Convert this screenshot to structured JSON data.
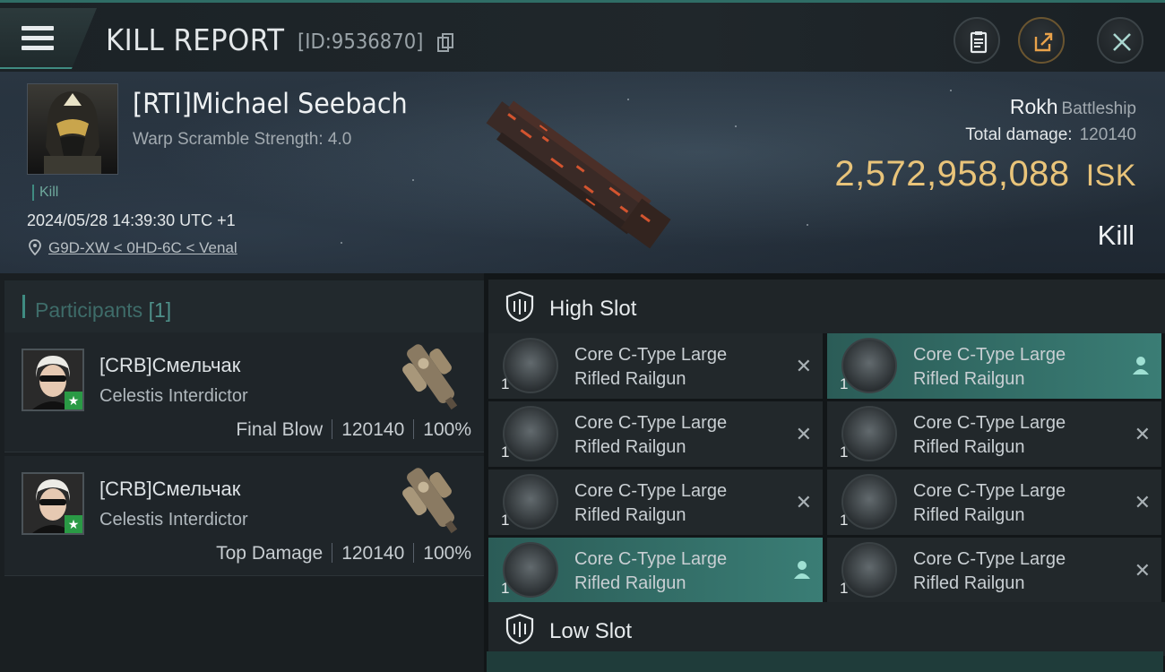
{
  "header": {
    "title": "KILL REPORT",
    "report_id": "[ID:9536870]"
  },
  "victim": {
    "name": "[RTI]Michael Seebach",
    "warp_scramble": "Warp Scramble Strength: 4.0",
    "kill_tag": "Kill",
    "datetime": "2024/05/28 14:39:30 UTC +1",
    "location": "G9D-XW < 0HD-6C < Venal"
  },
  "ship": {
    "name": "Rokh",
    "class": "Battleship",
    "total_damage_label": "Total damage:",
    "total_damage": "120140",
    "isk_value": "2,572,958,088",
    "isk_unit": "ISK",
    "result": "Kill"
  },
  "participants": {
    "label": "Participants",
    "count": "[1]",
    "rows": [
      {
        "name": "[CRB]Смельчак",
        "ship": "Celestis Interdictor",
        "role": "Final Blow",
        "damage": "120140",
        "percent": "100%"
      },
      {
        "name": "[CRB]Смельчак",
        "ship": "Celestis Interdictor",
        "role": "Top Damage",
        "damage": "120140",
        "percent": "100%"
      }
    ]
  },
  "slots": {
    "high_label": "High Slot",
    "low_label": "Low Slot",
    "items": [
      {
        "line1": "Core C-Type Large",
        "line2": "Rifled Railgun",
        "qty": "1",
        "action": "✕"
      },
      {
        "line1": "Core C-Type Large",
        "line2": "Rifled Railgun",
        "qty": "1",
        "action": "person"
      },
      {
        "line1": "Core C-Type Large",
        "line2": "Rifled Railgun",
        "qty": "1",
        "action": "✕"
      },
      {
        "line1": "Core C-Type Large",
        "line2": "Rifled Railgun",
        "qty": "1",
        "action": "✕"
      },
      {
        "line1": "Core C-Type Large",
        "line2": "Rifled Railgun",
        "qty": "1",
        "action": "✕"
      },
      {
        "line1": "Core C-Type Large",
        "line2": "Rifled Railgun",
        "qty": "1",
        "action": "✕"
      },
      {
        "line1": "Core C-Type Large",
        "line2": "Rifled Railgun",
        "qty": "1",
        "action": "person"
      },
      {
        "line1": "Core C-Type Large",
        "line2": "Rifled Railgun",
        "qty": "1",
        "action": "✕"
      }
    ]
  },
  "colors": {
    "accent": "#3f8b81",
    "isk": "#e9c47a",
    "highlight": "#3a7d75"
  }
}
